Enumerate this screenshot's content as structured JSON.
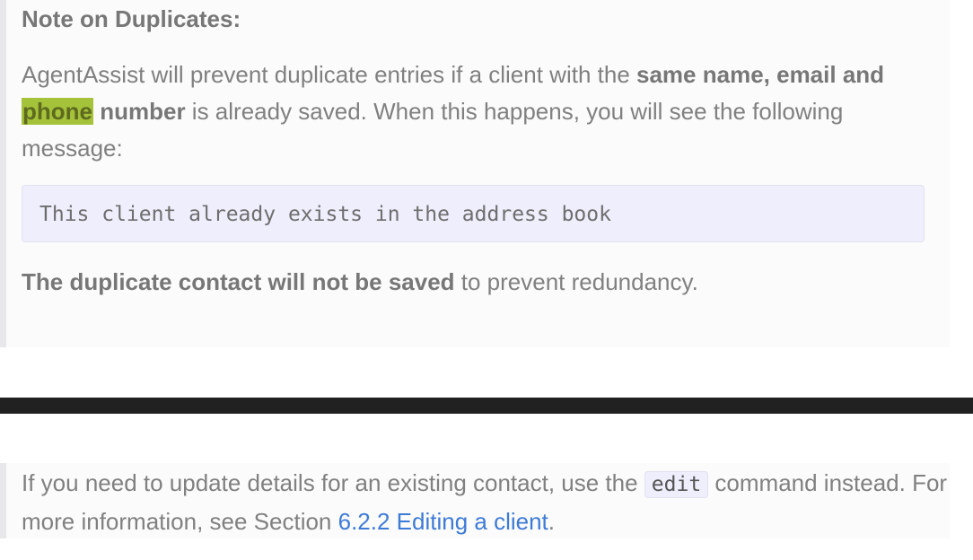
{
  "note": {
    "title": "Note on Duplicates:",
    "intro_1": "AgentAssist will prevent duplicate entries if a client with the ",
    "bold_1": "same name, email and",
    "highlight": "phone",
    "bold_2": " number",
    "intro_2": " is already saved. When this happens, you will see the following message:",
    "code_message": "This client already exists in the address book",
    "conclusion_bold": "The duplicate contact will not be saved",
    "conclusion_rest": " to prevent redundancy."
  },
  "tip": {
    "text_1": "If you need to update details for an existing contact, use the ",
    "command": "edit",
    "text_2": " command instead. For more information, see Section ",
    "link_label": "6.2.2 Editing a client",
    "text_3": "."
  },
  "colors": {
    "highlight": "#a4c23a",
    "link": "#3e7bd6",
    "code_background": "#eeeefc",
    "divider": "#212121"
  }
}
